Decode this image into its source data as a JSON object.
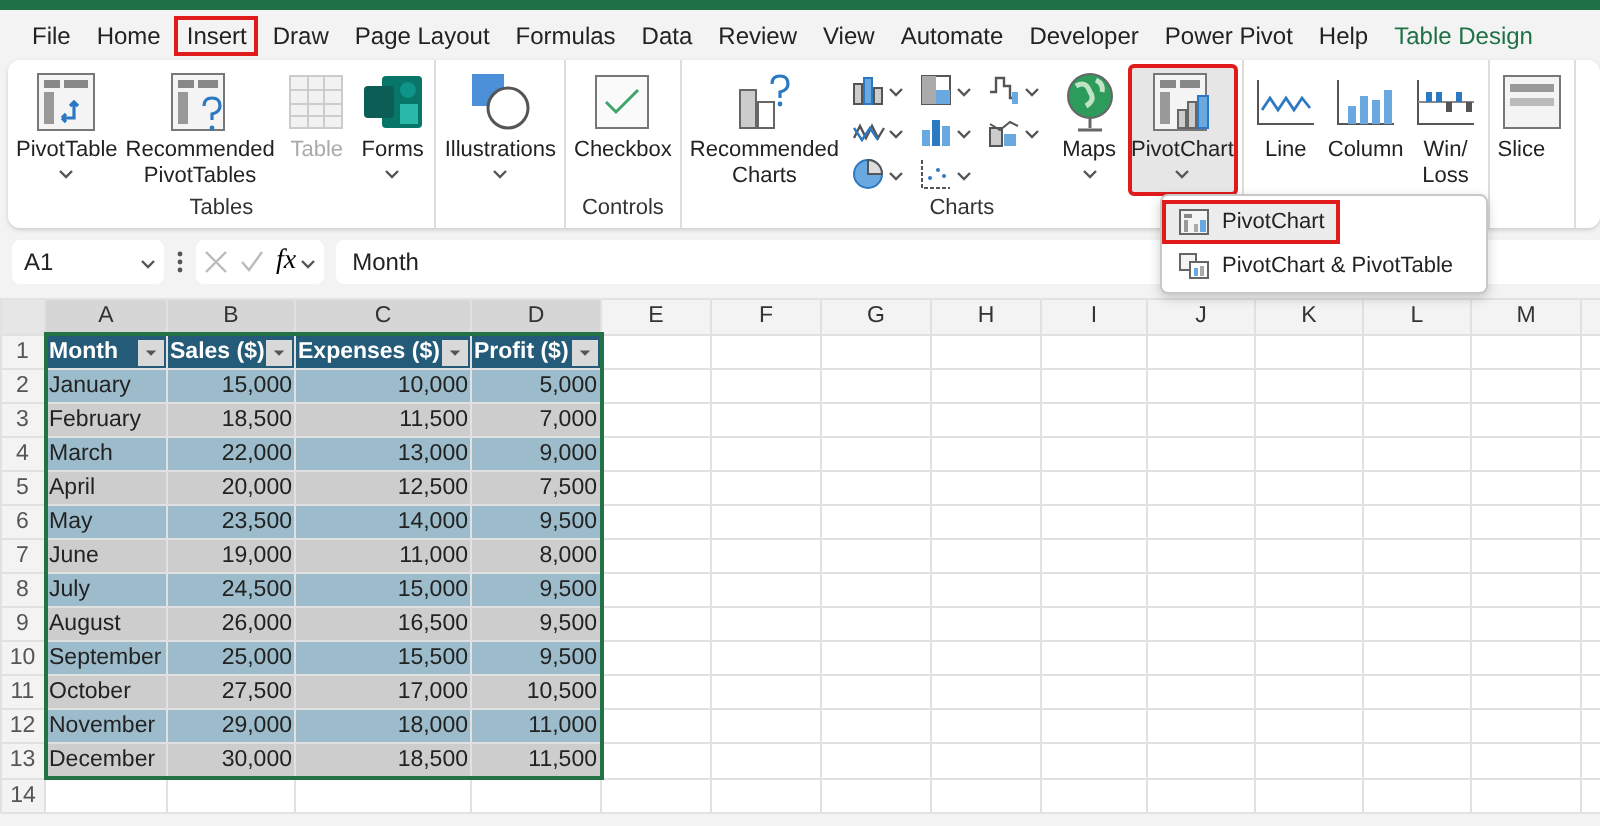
{
  "menu_tabs": [
    {
      "label": "File",
      "selected": false,
      "kind": "standard"
    },
    {
      "label": "Home",
      "selected": false,
      "kind": "standard"
    },
    {
      "label": "Insert",
      "selected": true,
      "kind": "standard"
    },
    {
      "label": "Draw",
      "selected": false,
      "kind": "standard"
    },
    {
      "label": "Page Layout",
      "selected": false,
      "kind": "standard"
    },
    {
      "label": "Formulas",
      "selected": false,
      "kind": "standard"
    },
    {
      "label": "Data",
      "selected": false,
      "kind": "standard"
    },
    {
      "label": "Review",
      "selected": false,
      "kind": "standard"
    },
    {
      "label": "View",
      "selected": false,
      "kind": "standard"
    },
    {
      "label": "Automate",
      "selected": false,
      "kind": "standard"
    },
    {
      "label": "Developer",
      "selected": false,
      "kind": "standard"
    },
    {
      "label": "Power Pivot",
      "selected": false,
      "kind": "standard"
    },
    {
      "label": "Help",
      "selected": false,
      "kind": "standard"
    },
    {
      "label": "Table Design",
      "selected": false,
      "kind": "contextual"
    }
  ],
  "ribbon": {
    "groups": [
      {
        "label": "Tables",
        "chart_gallery": false,
        "buttons": [
          {
            "label": "PivotTable",
            "dropdown": true,
            "disabled": false,
            "selected": false
          },
          {
            "label": "Recommended PivotTables",
            "dropdown": false,
            "disabled": false,
            "selected": false
          },
          {
            "label": "Table",
            "dropdown": false,
            "disabled": true,
            "selected": false
          },
          {
            "label": "Forms",
            "dropdown": true,
            "disabled": false,
            "selected": false
          }
        ]
      },
      {
        "chart_gallery": false,
        "buttons": [
          {
            "label": "Illustrations",
            "dropdown": true,
            "disabled": false,
            "selected": false
          }
        ]
      },
      {
        "label": "Controls",
        "chart_gallery": false,
        "buttons": [
          {
            "label": "Checkbox",
            "dropdown": false,
            "disabled": false,
            "selected": false
          }
        ]
      },
      {
        "label": "Charts",
        "chart_gallery": true,
        "buttons": [
          {
            "label": "Recommended Charts",
            "dropdown": false,
            "disabled": false,
            "selected": false
          },
          {
            "label": "Maps",
            "dropdown": true,
            "disabled": false,
            "selected": false
          },
          {
            "label": "PivotChart",
            "dropdown": true,
            "disabled": false,
            "selected": true
          }
        ]
      },
      {
        "chart_gallery": false,
        "buttons": [
          {
            "label": "Line",
            "dropdown": false,
            "disabled": false,
            "selected": false
          },
          {
            "label": "Column",
            "dropdown": false,
            "disabled": false,
            "selected": false
          },
          {
            "label": "Win/\nLoss",
            "dropdown": false,
            "disabled": false,
            "selected": false
          }
        ]
      },
      {
        "chart_gallery": false,
        "buttons": [
          {
            "label": "Slice",
            "dropdown": false,
            "disabled": false,
            "selected": false
          }
        ]
      }
    ]
  },
  "dropdown_menu": {
    "items": [
      {
        "label": "PivotChart",
        "selected": true
      },
      {
        "label": "PivotChart & PivotTable",
        "selected": false
      }
    ]
  },
  "formula_bar": {
    "name_box": "A1",
    "function_label": "fx",
    "formula": "Month"
  },
  "sheet": {
    "columns": [
      "A",
      "B",
      "C",
      "D",
      "E",
      "F",
      "G",
      "H",
      "I",
      "J",
      "K",
      "L",
      "M"
    ],
    "row_numbers": [
      "1",
      "2",
      "3",
      "4",
      "5",
      "6",
      "7",
      "8",
      "9",
      "10",
      "11",
      "12",
      "13",
      "14"
    ],
    "table": {
      "header": [
        "Month",
        "Sales ($)",
        "Expenses ($)",
        "Profit ($)"
      ],
      "rows": [
        [
          "January",
          "15,000",
          "10,000",
          "5,000"
        ],
        [
          "February",
          "18,500",
          "11,500",
          "7,000"
        ],
        [
          "March",
          "22,000",
          "13,000",
          "9,000"
        ],
        [
          "April",
          "20,000",
          "12,500",
          "7,500"
        ],
        [
          "May",
          "23,500",
          "14,000",
          "9,500"
        ],
        [
          "June",
          "19,000",
          "11,000",
          "8,000"
        ],
        [
          "July",
          "24,500",
          "15,000",
          "9,500"
        ],
        [
          "August",
          "26,000",
          "16,500",
          "9,500"
        ],
        [
          "September",
          "25,000",
          "15,500",
          "9,500"
        ],
        [
          "October",
          "27,500",
          "17,000",
          "10,500"
        ],
        [
          "November",
          "29,000",
          "18,000",
          "11,000"
        ],
        [
          "December",
          "30,000",
          "18,500",
          "11,500"
        ]
      ]
    }
  }
}
